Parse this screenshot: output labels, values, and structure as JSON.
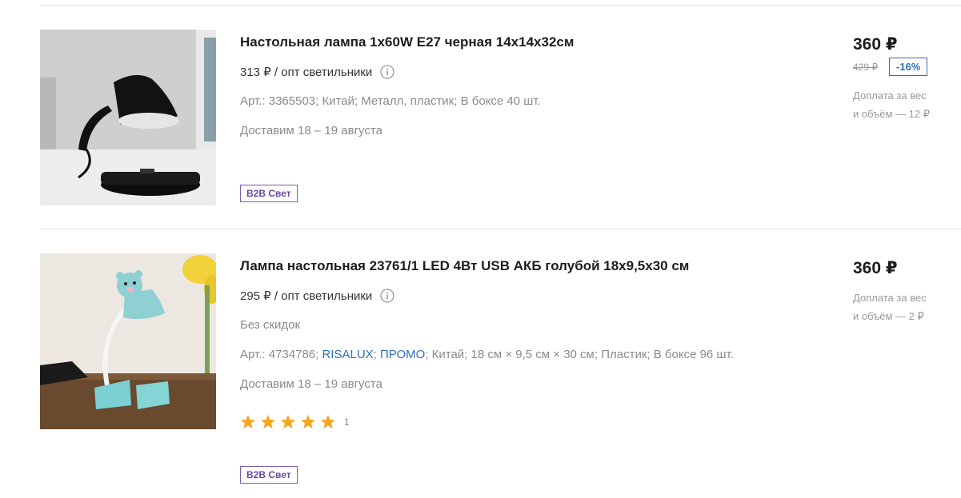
{
  "products": [
    {
      "title": "Настольная лампа 1x60W E27 черная 14x14x32см",
      "wholesale": "313 ₽ / опт светильники",
      "article": "Арт.: 3365503; Китай; Металл, пластик; В боксе 40 шт.",
      "delivery": "Доставим 18 – 19 августа",
      "badge": "B2B Свет",
      "price": "360 ₽",
      "old_price": "429 ₽",
      "discount": "-16%",
      "extra_line1": "Доплата за вес",
      "extra_line2": "и объём — 12 ₽",
      "image_icon": "black-desk-lamp-photo"
    },
    {
      "title": "Лампа настольная 23761/1 LED 4Вт USB АКБ голубой 18x9,5x30 см",
      "wholesale": "295 ₽ / опт светильники",
      "no_discount": "Без скидок",
      "article_prefix": "Арт.: 4734786;",
      "brand": "RISALUX",
      "sep1": ";",
      "promo": "ПРОМО",
      "article_rest": "; Китай; 18 см × 9,5 см × 30 см; Пластик; В боксе 96 шт.",
      "delivery": "Доставим 18 – 19 августа",
      "rating": 5,
      "review_count": "1",
      "badge": "B2B Свет",
      "price": "360 ₽",
      "extra_line1": "Доплата за вес",
      "extra_line2": "и объём — 2 ₽",
      "image_icon": "blue-bear-lamp-photo"
    }
  ],
  "colors": {
    "badge_border": "#7b5ea8",
    "link_blue": "#2f6fb7",
    "star_gold": "#f5a623"
  }
}
